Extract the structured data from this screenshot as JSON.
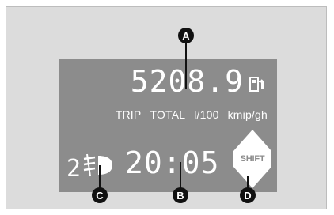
{
  "display": {
    "odometer": "5208.9",
    "units": [
      "TRIP",
      "TOTAL",
      "l/100",
      "kmip/gh"
    ],
    "gear": "2",
    "clock": "20:05",
    "shift_label": "SHIFT"
  },
  "callouts": {
    "a": "A",
    "b": "B",
    "c": "C",
    "d": "D"
  },
  "colors": {
    "background": "#dcdcdc",
    "display": "#8c8c8c",
    "segment": "#ffffff",
    "callout": "#111111"
  },
  "icons": {
    "fuel": "fuel-pump-icon",
    "lamp": "headlamp-icon",
    "shift": "shift-arrows-icon"
  }
}
